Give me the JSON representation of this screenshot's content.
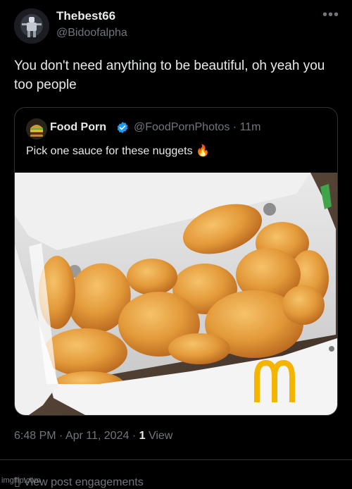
{
  "author": {
    "display_name": "Thebest66",
    "handle": "@Bidoofalpha",
    "avatar_icon": "robot-figure-avatar-icon"
  },
  "more_icon": "more-horizontal-icon",
  "tweet": {
    "text": "You don't need anything to be beautiful, oh yeah you too people"
  },
  "quoted": {
    "display_name": "Food Porn",
    "verified_icon": "verified-badge-icon",
    "handle": "@FoodPornPhotos",
    "separator": "·",
    "time": "11m",
    "text": "Pick one sauce for these nuggets",
    "emoji": "🔥",
    "media": {
      "subject": "chicken nuggets in an open cardboard box",
      "logo_letter": "M"
    }
  },
  "meta": {
    "time": "6:48 PM",
    "dot1": "·",
    "date": "Apr 11, 2024",
    "dot2": "·",
    "views_count": "1",
    "views_label": "View"
  },
  "engagements_label": "View post engagements",
  "watermark": "imgflip.com",
  "colors": {
    "background": "#000000",
    "text_primary": "#e7e9ea",
    "text_secondary": "#71767b",
    "verified_blue": "#1d9bf0",
    "border": "#2f3336",
    "logo_gold": "#f5b400"
  }
}
